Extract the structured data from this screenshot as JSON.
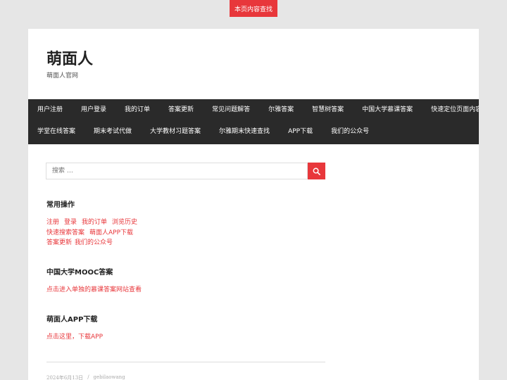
{
  "top_button": "本页内容查找",
  "site": {
    "title": "萌面人",
    "description": "萌面人官网"
  },
  "nav": {
    "row1": [
      "用户注册",
      "用户登录",
      "我的订单",
      "答案更新",
      "常见问题解答",
      "尔雅答案",
      "智慧树答案",
      "中国大学慕课答案",
      "快速定位页面内容"
    ],
    "row2": [
      "学堂在线答案",
      "期末考试代做",
      "大学教材习题答案",
      "尔雅期末快速查找",
      "APP下载",
      "我们的公众号"
    ]
  },
  "search": {
    "placeholder": "搜索 …"
  },
  "widgets": {
    "common": {
      "title": "常用操作",
      "line1": [
        "注册",
        "登录",
        "我的订单",
        "浏览历史"
      ],
      "line2": [
        "快速搜索答案",
        "萌面人APP下载"
      ],
      "line3": [
        "答案更新",
        "我们的公众号"
      ]
    },
    "mooc": {
      "title": "中国大学MOOC答案",
      "link": "点击进入单独的慕课答案网站查看"
    },
    "app": {
      "title": "萌面人APP下载",
      "link": "点击这里，下载APP"
    }
  },
  "post_meta": {
    "date": "2024年6月13日",
    "separator": "/",
    "author": "gebilaowang"
  },
  "colors": {
    "accent": "#e8373b",
    "nav_bg": "#2a2a2a",
    "page_bg": "#e6e6e6"
  }
}
